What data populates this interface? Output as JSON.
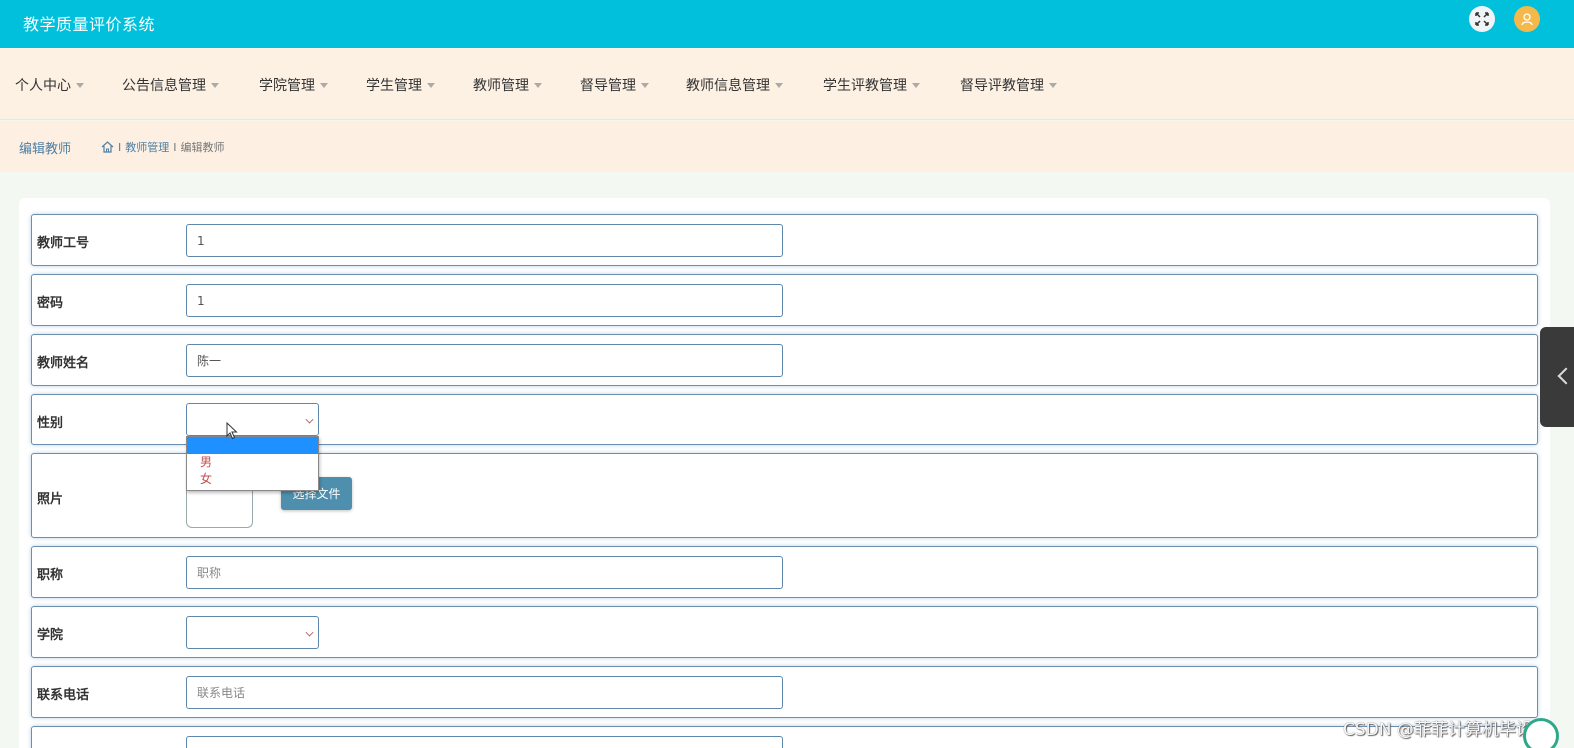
{
  "header": {
    "title": "教学质量评价系统",
    "expand_icon": "fullscreen-icon",
    "avatar_icon": "user-avatar-icon"
  },
  "nav": {
    "items": [
      {
        "label": "个人中心"
      },
      {
        "label": "公告信息管理"
      },
      {
        "label": "学院管理"
      },
      {
        "label": "学生管理"
      },
      {
        "label": "教师管理"
      },
      {
        "label": "督导管理"
      },
      {
        "label": "教师信息管理"
      },
      {
        "label": "学生评教管理"
      },
      {
        "label": "督导评教管理"
      }
    ]
  },
  "page": {
    "title": "编辑教师",
    "breadcrumb": {
      "parent": "教师管理",
      "current": "编辑教师",
      "separator": "I"
    }
  },
  "form": {
    "teacher_id": {
      "label": "教师工号",
      "value": "1"
    },
    "password": {
      "label": "密码",
      "value": "1"
    },
    "teacher_name": {
      "label": "教师姓名",
      "value": "陈一"
    },
    "gender": {
      "label": "性别",
      "value": "",
      "options": [
        "",
        "男",
        "女"
      ]
    },
    "photo": {
      "label": "照片",
      "button": "选择文件"
    },
    "title_field": {
      "label": "职称",
      "placeholder": "职称"
    },
    "college": {
      "label": "学院",
      "value": ""
    },
    "phone": {
      "label": "联系电话",
      "placeholder": "联系电话"
    }
  },
  "watermark": "CSDN @菲菲计算机毕设",
  "colors": {
    "header_bg": "#00c0dc",
    "nav_bg": "#fdf1e4",
    "accent_blue": "#4d8fad",
    "option_text": "#c0504d",
    "dropdown_highlight": "#1e90ff"
  }
}
